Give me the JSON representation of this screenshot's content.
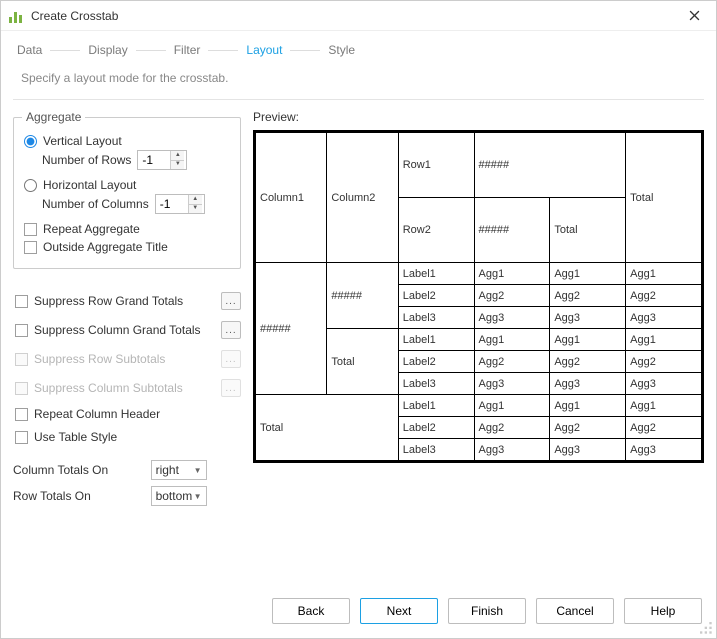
{
  "window": {
    "title": "Create Crosstab"
  },
  "steps": {
    "items": [
      "Data",
      "Display",
      "Filter",
      "Layout",
      "Style"
    ],
    "activeIndex": 3
  },
  "description": "Specify a layout mode for the crosstab.",
  "aggregate": {
    "legend": "Aggregate",
    "vertical": {
      "label": "Vertical Layout",
      "rowsLabel": "Number of Rows",
      "rowsValue": "-1",
      "checked": true
    },
    "horizontal": {
      "label": "Horizontal Layout",
      "colsLabel": "Number of Columns",
      "colsValue": "-1",
      "checked": false
    },
    "repeat": {
      "label": "Repeat Aggregate",
      "checked": false
    },
    "outside": {
      "label": "Outside Aggregate Title",
      "checked": false
    }
  },
  "options": {
    "suppressRowGrand": {
      "label": "Suppress Row Grand Totals",
      "enabled": true,
      "moreEnabled": true
    },
    "suppressColGrand": {
      "label": "Suppress Column Grand Totals",
      "enabled": true,
      "moreEnabled": true
    },
    "suppressRowSub": {
      "label": "Suppress Row Subtotals",
      "enabled": false,
      "moreEnabled": false
    },
    "suppressColSub": {
      "label": "Suppress Column Subtotals",
      "enabled": false,
      "moreEnabled": false
    },
    "repeatColHeader": {
      "label": "Repeat Column Header"
    },
    "useTableStyle": {
      "label": "Use Table Style"
    },
    "more": "..."
  },
  "totals": {
    "colLabel": "Column Totals On",
    "colValue": "right",
    "rowLabel": "Row Totals On",
    "rowValue": "bottom"
  },
  "preview": {
    "label": "Preview:",
    "header": {
      "col1": "Column1",
      "col2": "Column2",
      "row1": "Row1",
      "row2": "Row2",
      "hash": "#####",
      "total": "Total"
    },
    "blocks": [
      {
        "side1": "#####",
        "side2": "#####",
        "rows": [
          {
            "label": "Label1",
            "v": [
              "Agg1",
              "Agg1",
              "Agg1"
            ]
          },
          {
            "label": "Label2",
            "v": [
              "Agg2",
              "Agg2",
              "Agg2"
            ]
          },
          {
            "label": "Label3",
            "v": [
              "Agg3",
              "Agg3",
              "Agg3"
            ]
          }
        ]
      },
      {
        "side2": "Total",
        "rows": [
          {
            "label": "Label1",
            "v": [
              "Agg1",
              "Agg1",
              "Agg1"
            ]
          },
          {
            "label": "Label2",
            "v": [
              "Agg2",
              "Agg2",
              "Agg2"
            ]
          },
          {
            "label": "Label3",
            "v": [
              "Agg3",
              "Agg3",
              "Agg3"
            ]
          }
        ]
      },
      {
        "side1": "Total",
        "rows": [
          {
            "label": "Label1",
            "v": [
              "Agg1",
              "Agg1",
              "Agg1"
            ]
          },
          {
            "label": "Label2",
            "v": [
              "Agg2",
              "Agg2",
              "Agg2"
            ]
          },
          {
            "label": "Label3",
            "v": [
              "Agg3",
              "Agg3",
              "Agg3"
            ]
          }
        ]
      }
    ]
  },
  "footer": {
    "back": "Back",
    "next": "Next",
    "finish": "Finish",
    "cancel": "Cancel",
    "help": "Help"
  }
}
